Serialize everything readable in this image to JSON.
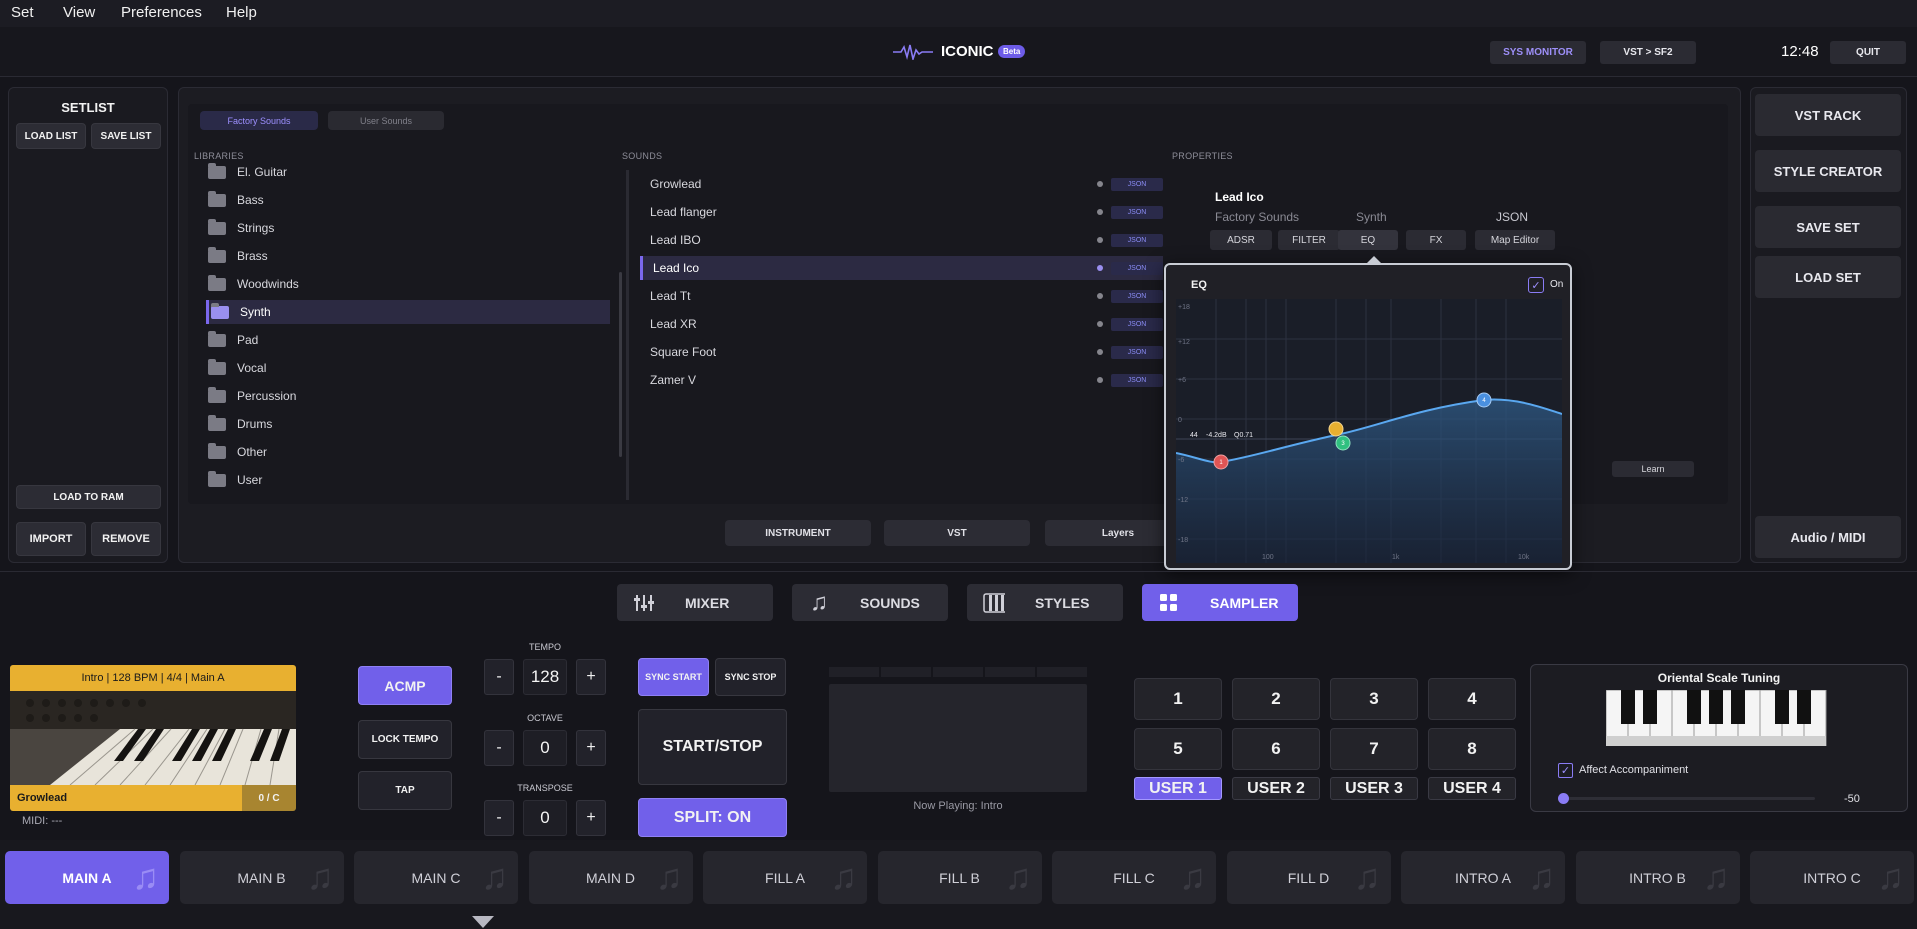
{
  "menu": [
    "Set",
    "View",
    "Preferences",
    "Help"
  ],
  "header": {
    "app_title": "ICONIC",
    "beta": "Beta",
    "sys_monitor": "SYS MONITOR",
    "vst_sf2": "VST > SF2",
    "clock": "12:48",
    "quit": "QUIT"
  },
  "setlist": {
    "title": "SETLIST",
    "load_list": "LOAD LIST",
    "save_list": "SAVE LIST",
    "load_to_ram": "LOAD TO RAM",
    "import": "IMPORT",
    "remove": "REMOVE"
  },
  "browser": {
    "tabs": [
      "Factory Sounds",
      "User Sounds"
    ],
    "libraries_label": "LIBRARIES",
    "sounds_label": "SOUNDS",
    "properties_label": "PROPERTIES",
    "libraries": [
      "El. Guitar",
      "Bass",
      "Strings",
      "Brass",
      "Woodwinds",
      "Synth",
      "Pad",
      "Vocal",
      "Percussion",
      "Drums",
      "Other",
      "User"
    ],
    "selected_library": "Synth",
    "sounds": [
      "Growlead",
      "Lead flanger",
      "Lead IBO",
      "Lead Ico",
      "Lead Tt",
      "Lead XR",
      "Square Foot",
      "Zamer V"
    ],
    "selected_sound": "Lead Ico",
    "json_tag": "JSON",
    "bottom_tabs": [
      "INSTRUMENT",
      "VST",
      "Layers"
    ]
  },
  "properties": {
    "name": "Lead Ico",
    "library": "Factory Sounds",
    "category": "Synth",
    "format": "JSON",
    "tabs": [
      "ADSR",
      "FILTER",
      "EQ",
      "FX",
      "Map Editor"
    ],
    "learn": "Learn"
  },
  "eq": {
    "title": "EQ",
    "on_label": "On",
    "on": true,
    "y_ticks": [
      "+18",
      "+12",
      "+6",
      "0",
      "-6",
      "-12",
      "-18"
    ],
    "x_ticks": [
      "100",
      "1k",
      "10k"
    ],
    "readout": {
      "freq": "44",
      "gain": "-4.2dB",
      "q": "Q0.71"
    },
    "bands": [
      {
        "label": "1",
        "color": "#e05555"
      },
      {
        "label": "2",
        "color": "#e8b030"
      },
      {
        "label": "3",
        "color": "#30c080"
      },
      {
        "label": "4",
        "color": "#4a90e0"
      }
    ]
  },
  "side": {
    "vst_rack": "VST RACK",
    "style_creator": "STYLE CREATOR",
    "save_set": "SAVE SET",
    "load_set": "LOAD SET",
    "audio_midi": "Audio / MIDI"
  },
  "nav": [
    "MIXER",
    "SOUNDS",
    "STYLES",
    "SAMPLER"
  ],
  "nav_active": "SAMPLER",
  "status": {
    "info": "Intro | 128 BPM | 4/4 | Main A",
    "sound": "Growlead",
    "counter": "0 / C",
    "midi": "MIDI: ---"
  },
  "controls": {
    "acmp": "ACMP",
    "lock_tempo": "LOCK TEMPO",
    "tap": "TAP",
    "tempo_label": "TEMPO",
    "tempo": "128",
    "octave_label": "OCTAVE",
    "octave": "0",
    "transpose_label": "TRANSPOSE",
    "transpose": "0",
    "minus": "-",
    "plus": "+",
    "sync_start": "SYNC START",
    "sync_stop": "SYNC STOP",
    "start_stop": "START/STOP",
    "split": "SPLIT: ON"
  },
  "now_playing": "Now Playing: Intro",
  "pads": [
    "1",
    "2",
    "3",
    "4",
    "5",
    "6",
    "7",
    "8"
  ],
  "users": [
    "USER 1",
    "USER 2",
    "USER 3",
    "USER 4"
  ],
  "active_user": "USER 1",
  "tuning": {
    "title": "Oriental Scale Tuning",
    "affect": "Affect Accompaniment",
    "value": "-50"
  },
  "variations": [
    "MAIN A",
    "MAIN B",
    "MAIN C",
    "MAIN D",
    "FILL A",
    "FILL B",
    "FILL C",
    "FILL D",
    "INTRO A",
    "INTRO B",
    "INTRO C"
  ],
  "active_variation": "MAIN A",
  "colors": {
    "accent": "#7b68ee",
    "status_gold": "#e8b030",
    "bg": "#15151b"
  }
}
